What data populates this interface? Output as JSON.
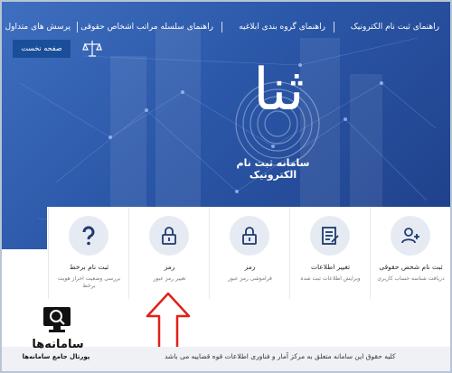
{
  "nav": {
    "items": [
      "راهنمای ثبت نام الکترونیک",
      "راهنمای گروه بندی ابلاغیه",
      "راهنمای سلسله مراتب اشخاص حقوقی",
      "پرسش های متداول"
    ],
    "home": "صفحه نخست"
  },
  "hero": {
    "glyph": "ثنا",
    "title": "سامانه ثبت نام الکترونیک"
  },
  "cards": [
    {
      "title": "ثبت نام شخص حقوقی",
      "subtitle": "دریافت شناسه حساب کاربری",
      "icon": "add-user-icon"
    },
    {
      "title": "تغییر اطلاعات",
      "subtitle": "ویرایش اطلاعات ثبت شده",
      "icon": "edit-document-icon"
    },
    {
      "title": "رمز",
      "subtitle": "فراموشی رمز عبور",
      "icon": "lock-icon"
    },
    {
      "title": "رمز",
      "subtitle": "تغییر رمز عبور",
      "icon": "lock-icon"
    },
    {
      "title": "ثبت نام برخط",
      "subtitle": "بررسی وضعیت احراز هویت برخط",
      "icon": "question-icon"
    }
  ],
  "footer": {
    "text": "کلیه حقوق این سامانه متعلق به مرکز آمار و فناوری اطلاعات قوه قضاییه می باشد"
  },
  "brand": {
    "name": "سامانه‌ها",
    "subtitle": "پورتال جامع سامانه‌ها"
  },
  "colors": {
    "hero": "#2b57a8",
    "home_button": "#1a4e99",
    "icon_circle": "#e6ebf3",
    "icon_stroke": "#1f3b6d",
    "arrow": "#e0201b"
  }
}
